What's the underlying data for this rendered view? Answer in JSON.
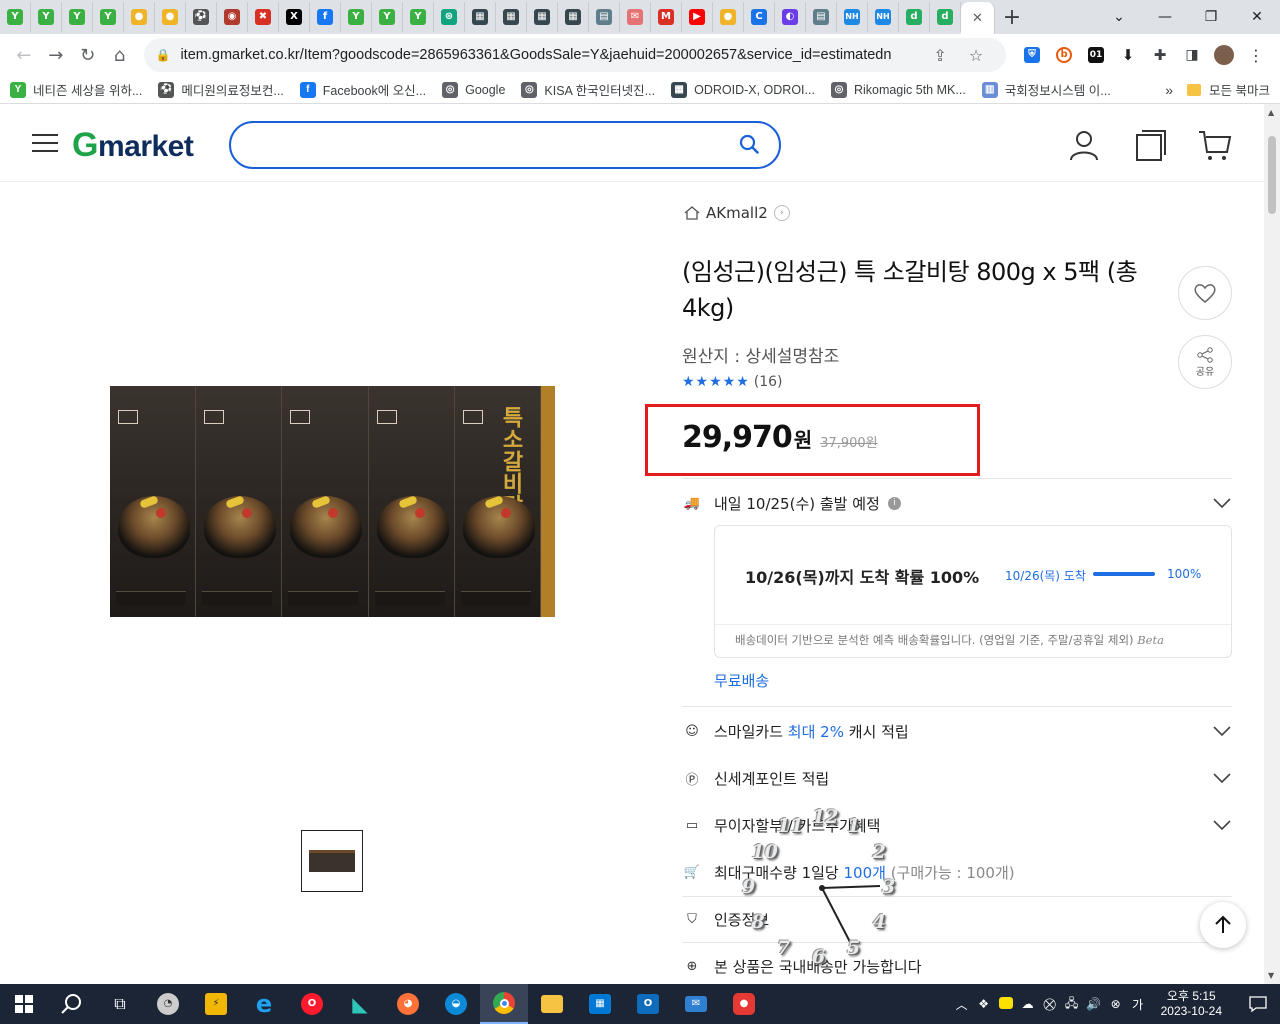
{
  "browser": {
    "tabs": [
      {
        "icon": "sprout-icon",
        "color": "#3bb143",
        "glyph": "Y"
      },
      {
        "icon": "sprout-icon",
        "color": "#3bb143",
        "glyph": "Y"
      },
      {
        "icon": "sprout-icon",
        "color": "#3bb143",
        "glyph": "Y"
      },
      {
        "icon": "sprout-icon",
        "color": "#3bb143",
        "glyph": "Y"
      },
      {
        "icon": "gov-emblem-icon",
        "color": "#f0b429",
        "glyph": "●"
      },
      {
        "icon": "gov-emblem-icon",
        "color": "#f0b429",
        "glyph": "●"
      },
      {
        "icon": "soccer-icon",
        "color": "#555555",
        "glyph": "⚽"
      },
      {
        "icon": "seal-icon",
        "color": "#b03a2e",
        "glyph": "◉"
      },
      {
        "icon": "cross-icon",
        "color": "#d93025",
        "glyph": "✖"
      },
      {
        "icon": "x-logo-icon",
        "color": "#000000",
        "glyph": "X"
      },
      {
        "icon": "facebook-icon",
        "color": "#1877f2",
        "glyph": "f"
      },
      {
        "icon": "sprout-icon",
        "color": "#3bb143",
        "glyph": "Y"
      },
      {
        "icon": "sprout-icon",
        "color": "#3bb143",
        "glyph": "Y"
      },
      {
        "icon": "sprout-icon",
        "color": "#3bb143",
        "glyph": "Y"
      },
      {
        "icon": "openai-icon",
        "color": "#10a37f",
        "glyph": "⊛"
      },
      {
        "icon": "building-icon",
        "color": "#37474f",
        "glyph": "▦"
      },
      {
        "icon": "building-icon",
        "color": "#37474f",
        "glyph": "▦"
      },
      {
        "icon": "building-icon",
        "color": "#37474f",
        "glyph": "▦"
      },
      {
        "icon": "building-icon",
        "color": "#37474f",
        "glyph": "▦"
      },
      {
        "icon": "document-icon",
        "color": "#607d8b",
        "glyph": "▤"
      },
      {
        "icon": "mail-icon",
        "color": "#e57373",
        "glyph": "✉"
      },
      {
        "icon": "gmail-icon",
        "color": "#d93025",
        "glyph": "M"
      },
      {
        "icon": "youtube-icon",
        "color": "#ff0000",
        "glyph": "▶"
      },
      {
        "icon": "gov-emblem-icon",
        "color": "#f0b429",
        "glyph": "●"
      },
      {
        "icon": "c-logo-icon",
        "color": "#1a73e8",
        "glyph": "C"
      },
      {
        "icon": "purple-circle-icon",
        "color": "#6a3de8",
        "glyph": "◐"
      },
      {
        "icon": "document-icon",
        "color": "#607d8b",
        "glyph": "▤"
      },
      {
        "icon": "nh-bank-icon",
        "color": "#1e88e5",
        "glyph": "NH"
      },
      {
        "icon": "nh-bank-icon",
        "color": "#1e88e5",
        "glyph": "NH"
      },
      {
        "icon": "d-green-icon",
        "color": "#27ae60",
        "glyph": "d"
      },
      {
        "icon": "d-green-icon",
        "color": "#27ae60",
        "glyph": "d"
      }
    ],
    "active_tab_close": "✕",
    "new_tab": "+",
    "window": {
      "minimize": "⌄",
      "min": "—",
      "restore": "❐",
      "close": "✕"
    },
    "url": "item.gmarket.co.kr/Item?goodscode=2865963361&GoodsSale=Y&jaehuid=200002657&service_id=estimatedn",
    "bookmarks": [
      {
        "label": "네티즌 세상을 위하...",
        "icon": "sprout-icon",
        "color": "#3bb143",
        "glyph": "Y"
      },
      {
        "label": "메디원의료정보컨...",
        "icon": "soccer-icon",
        "color": "#555555",
        "glyph": "⚽"
      },
      {
        "label": "Facebook에 오신...",
        "icon": "facebook-icon",
        "color": "#1877f2",
        "glyph": "f"
      },
      {
        "label": "Google",
        "icon": "globe-icon",
        "color": "#5f6368",
        "glyph": "◎"
      },
      {
        "label": "KISA 한국인터넷진...",
        "icon": "globe-icon",
        "color": "#5f6368",
        "glyph": "◎"
      },
      {
        "label": "ODROID-X, ODROI...",
        "icon": "building-icon",
        "color": "#37474f",
        "glyph": "▦"
      },
      {
        "label": "Rikomagic 5th MK...",
        "icon": "globe-icon",
        "color": "#5f6368",
        "glyph": "◎"
      },
      {
        "label": "국회정보시스템 이...",
        "icon": "assembly-icon",
        "color": "#6b8fd6",
        "glyph": "▥"
      }
    ],
    "bookmarks_more": "»",
    "all_bookmarks": "모든 북마크"
  },
  "site": {
    "logo_g": "G",
    "logo_rest": "market",
    "search_placeholder": ""
  },
  "product": {
    "seller": "AKmall2",
    "title": "(임성근)(임성근) 특 소갈비탕 800g x 5팩 (총 4kg)",
    "origin": "원산지 : 상세설명참조",
    "stars": "★★★★★",
    "review_count": "(16)",
    "rating_fraction": 1.0,
    "price": "29,970",
    "price_unit": "원",
    "original_price": "37,900원",
    "package_title": "특소갈비탕",
    "share_label": "공유"
  },
  "delivery": {
    "headline": "내일 10/25(수) 출발 예정",
    "arrival_main": "10/26(목)까지 도착 확률 100%",
    "arrival_label": "10/26(목) 도착",
    "arrival_pct": "100%",
    "arrival_fraction": 1.0,
    "note": "배송데이터 기반으로 분석한 예측 배송확률입니다. (영업일 기준, 주말/공휴일 제외)",
    "beta": "Beta",
    "free": "무료배송"
  },
  "benefits": {
    "smile_pre": "스마일카드 ",
    "smile_hl": "최대 2%",
    "smile_post": " 캐시 적립",
    "shinsegae": "신세계포인트 적립",
    "installment": "무이자할부 / 카드추가혜택",
    "maxbuy_pre": "최대구매수량 1일당 ",
    "maxbuy_hl": "100개",
    "maxbuy_post": " (구매가능 : 100개)",
    "cert": "인증정보",
    "domestic": "본 상품은 국내배송만 가능합니다"
  },
  "overlay_clock": {
    "numbers": [
      "12",
      "1",
      "2",
      "3",
      "4",
      "5",
      "6",
      "7",
      "8",
      "9",
      "10",
      "11"
    ]
  },
  "taskbar": {
    "time": "오후 5:15",
    "date": "2023-10-24",
    "ime": "가"
  }
}
